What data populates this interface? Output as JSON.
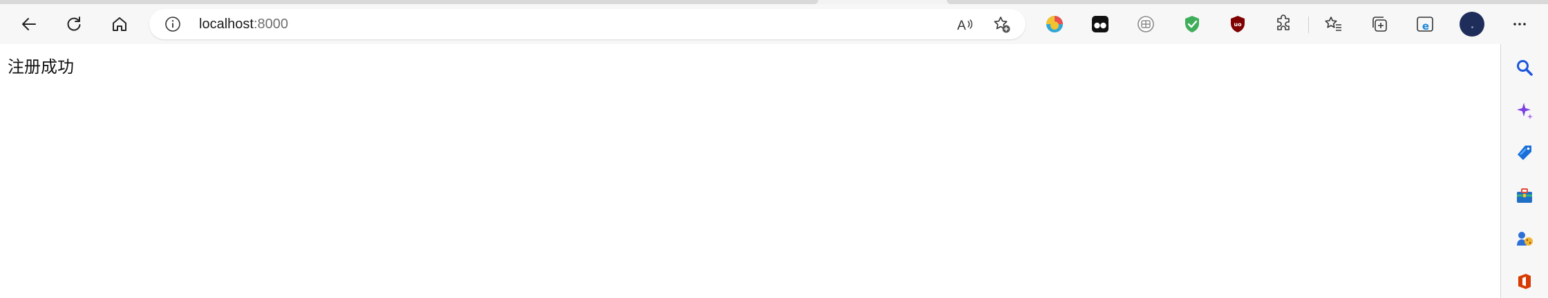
{
  "toolbar": {
    "back_icon": "back-arrow-icon",
    "refresh_icon": "refresh-icon",
    "home_icon": "home-icon",
    "more_icon": "more-horizontal-icon"
  },
  "address_bar": {
    "host": "localhost",
    "port": ":8000",
    "info_icon": "info-icon",
    "read_aloud_icon": "read-aloud-icon",
    "add_favorite_icon": "add-favorite-icon"
  },
  "extensions": [
    "colorful-ball-extension-icon",
    "tampermonkey-extension-icon",
    "gray-circle-extension-icon",
    "green-shield-extension-icon",
    "ublock-origin-extension-icon",
    "extensions-puzzle-icon"
  ],
  "toolbar_right": [
    "favorites-icon",
    "collections-icon",
    "ie-mode-icon",
    "profile-avatar"
  ],
  "page": {
    "message": "注册成功"
  },
  "sidebar": [
    "search-icon",
    "copilot-sparkle-icon",
    "shopping-tag-icon",
    "tools-briefcase-icon",
    "games-icon",
    "office-icon"
  ],
  "colors": {
    "toolbar_bg": "#f7f7f7",
    "avatar_bg": "#1f2d5a",
    "page_bg": "#ffffff",
    "search_blue": "#1a56db",
    "office_red": "#d83b01"
  }
}
